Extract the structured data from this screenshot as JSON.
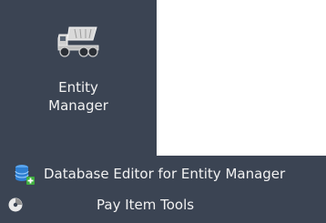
{
  "ribbon": {
    "entity_manager": {
      "label_line1": "Entity",
      "label_line2": "Manager",
      "icon": "dump-truck-icon"
    },
    "database_editor": {
      "label": "Database Editor for Entity Manager",
      "icon": "database-add-icon"
    },
    "pay_item_tools": {
      "label": "Pay Item Tools",
      "icon": "pay-item-tools-icon"
    }
  },
  "colors": {
    "panel_bg": "#3b4453",
    "text": "#f2f2f2",
    "truck_body": "#cfcfcf",
    "db_blue": "#2f7fd1",
    "add_green": "#3fae3f"
  }
}
